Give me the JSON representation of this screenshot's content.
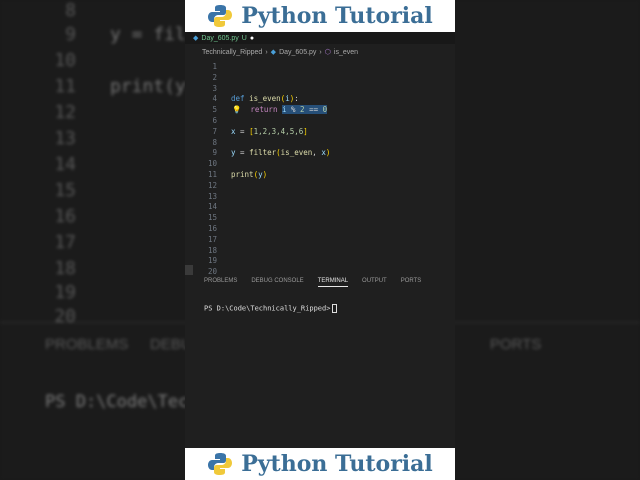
{
  "banner": {
    "title": "Python Tutorial"
  },
  "tab": {
    "filename": "Day_605.py",
    "status": "U"
  },
  "breadcrumb": [
    "Technically_Ripped",
    "Day_605.py",
    "is_even"
  ],
  "code": [
    {
      "n": "1",
      "t": ""
    },
    {
      "n": "2",
      "t": ""
    },
    {
      "n": "3",
      "t": ""
    },
    {
      "n": "4",
      "t": "def is_even(i):"
    },
    {
      "n": "5",
      "t": "return i % 2 == 0"
    },
    {
      "n": "6",
      "t": ""
    },
    {
      "n": "7",
      "t": "x = [1,2,3,4,5,6]"
    },
    {
      "n": "8",
      "t": ""
    },
    {
      "n": "9",
      "t": "y = filter(is_even, x)"
    },
    {
      "n": "10",
      "t": ""
    },
    {
      "n": "11",
      "t": "print(y)"
    },
    {
      "n": "12",
      "t": ""
    },
    {
      "n": "13",
      "t": ""
    },
    {
      "n": "14",
      "t": ""
    },
    {
      "n": "15",
      "t": ""
    },
    {
      "n": "16",
      "t": ""
    },
    {
      "n": "17",
      "t": ""
    },
    {
      "n": "18",
      "t": ""
    },
    {
      "n": "19",
      "t": ""
    },
    {
      "n": "20",
      "t": ""
    }
  ],
  "panel": {
    "tabs": [
      "PROBLEMS",
      "DEBUG CONSOLE",
      "TERMINAL",
      "OUTPUT",
      "PORTS"
    ],
    "active": "TERMINAL"
  },
  "terminal": {
    "prompt": "PS D:\\Code\\Technically_Ripped>"
  },
  "background": {
    "lines": [
      "8",
      "9",
      "10",
      "11",
      "12",
      "13",
      "14",
      "15",
      "16",
      "17",
      "18",
      "19",
      "20"
    ],
    "code1": "y = fil",
    "code2": "print(y",
    "tab1": "PROBLEMS",
    "tab2": "DEBU",
    "tab3": "PORTS",
    "term": "PS D:\\Code\\Tec"
  }
}
